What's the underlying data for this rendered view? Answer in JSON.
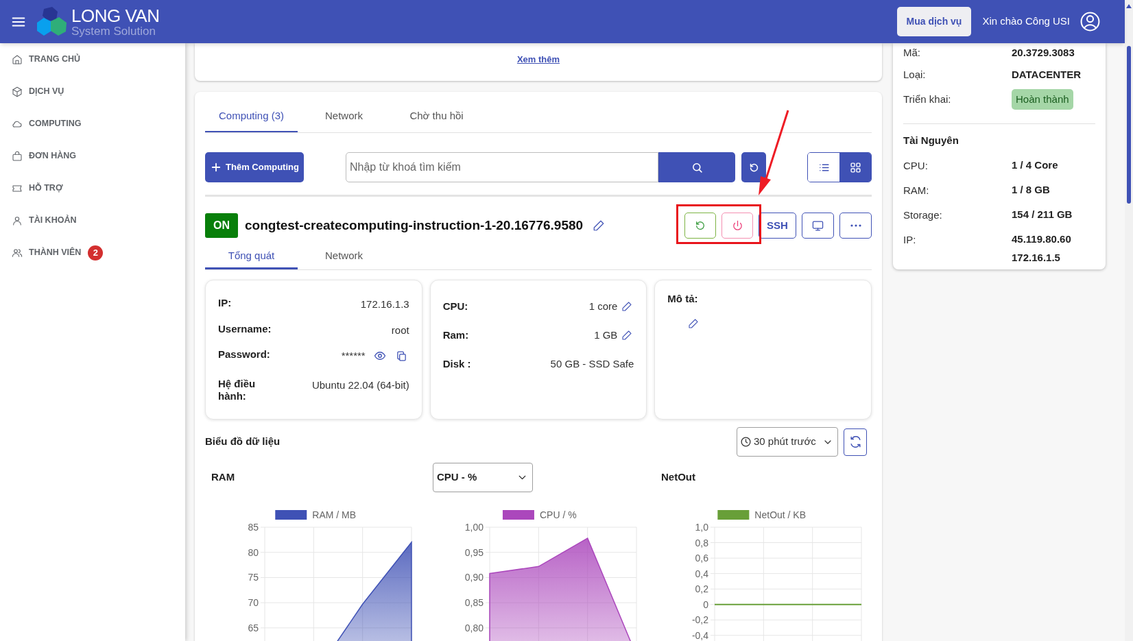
{
  "header": {
    "brand_title": "LONG VAN",
    "brand_subtitle": "System Solution",
    "buy_button": "Mua dịch vụ",
    "greeting": "Xin chào Công USI"
  },
  "sidebar": {
    "items": [
      {
        "label": "TRANG CHỦ",
        "selected": false
      },
      {
        "label": "DỊCH VỤ",
        "selected": false
      },
      {
        "label": "COMPUTING",
        "selected": false
      },
      {
        "label": "ĐƠN HÀNG",
        "selected": false
      },
      {
        "label": "HỖ TRỢ",
        "selected": false
      },
      {
        "label": "TÀI KHOẢN",
        "selected": false
      },
      {
        "label": "THÀNH VIÊN",
        "selected": false,
        "badge": "2"
      }
    ]
  },
  "top_card": {
    "link": "Xem thêm"
  },
  "tabs": [
    {
      "label": "Computing (3)",
      "selected": true
    },
    {
      "label": "Network",
      "selected": false
    },
    {
      "label": "Chờ thu hồi",
      "selected": false
    }
  ],
  "toolbar": {
    "add_button": "Thêm Computing",
    "search": {
      "placeholder": "Nhập từ khoá tìm kiếm"
    },
    "view_modes": [
      {
        "selected": false
      },
      {
        "selected": true
      }
    ]
  },
  "server": {
    "status": "ON",
    "name": "congtest-createcomputing-instruction-1-20.16776.9580",
    "ssh_button": "SSH",
    "subtabs": [
      {
        "label": "Tổng quát",
        "selected": true
      },
      {
        "label": "Network",
        "selected": false
      }
    ],
    "access": [
      {
        "label": "IP:",
        "value": "172.16.1.3"
      },
      {
        "label": "Username:",
        "value": "root"
      },
      {
        "label": "Password:",
        "value": "******",
        "kind": "secret"
      },
      {
        "label": "Hệ điều hành:",
        "value": "Ubuntu 22.04 (64-bit)"
      }
    ],
    "specs": [
      {
        "label": "CPU:",
        "value": "1 core",
        "editable": true
      },
      {
        "label": "Ram:",
        "value": "1 GB",
        "editable": true
      },
      {
        "label": "Disk :",
        "value": "50 GB - SSD Safe",
        "editable": false
      }
    ],
    "description": {
      "label": "Mô tả:"
    }
  },
  "charts_section": {
    "title": "Biểu đồ dữ liệu",
    "time_range": "30 phút trước",
    "charts": [
      {
        "title": "RAM",
        "chart_data": {
          "type": "area",
          "grid": true,
          "ylim": [
            50,
            85
          ],
          "yticks": [
            65,
            70,
            75,
            80,
            85
          ],
          "series": [
            {
              "name": "RAM / MB",
              "color": "#3f51b5",
              "values": [
                55,
                55.4,
                69.7,
                82
              ]
            }
          ]
        }
      },
      {
        "selector": "CPU - %",
        "chart_data": {
          "type": "area",
          "grid": true,
          "ylim": [
            0.65,
            1.0
          ],
          "yticks": [
            {
              "value": 0.8,
              "label": "0,80"
            },
            {
              "value": 0.85,
              "label": "0,85"
            },
            {
              "value": 0.9,
              "label": "0,90"
            },
            {
              "value": 0.95,
              "label": "0,95"
            },
            {
              "value": 1.0,
              "label": "1,00"
            }
          ],
          "series": [
            {
              "name": "CPU / %",
              "color": "#ab47bc",
              "values": [
                0.908,
                0.922,
                0.978,
                0.745
              ]
            }
          ]
        }
      },
      {
        "title": "NetOut",
        "chart_data": {
          "type": "line",
          "grid": true,
          "ylim": [
            -1.28,
            1.0
          ],
          "yticks": [
            {
              "value": -0.4,
              "label": "-0,4"
            },
            {
              "value": -0.2,
              "label": "-0,2"
            },
            {
              "value": 0,
              "label": "0"
            },
            {
              "value": 0.2,
              "label": "0,2"
            },
            {
              "value": 0.4,
              "label": "0,4"
            },
            {
              "value": 0.6,
              "label": "0,6"
            },
            {
              "value": 0.8,
              "label": "0,8"
            },
            {
              "value": 1.0,
              "label": "1,0"
            }
          ],
          "series": [
            {
              "name": "NetOut / KB",
              "color": "#689f38",
              "values": [
                0,
                0,
                0,
                0
              ]
            }
          ]
        }
      }
    ]
  },
  "info_panel": {
    "rows": [
      {
        "label": "Mã:",
        "value": "20.3729.3083"
      },
      {
        "label": "Loại:",
        "value": "DATACENTER"
      },
      {
        "label": "Triển khai:",
        "value": "Hoàn thành",
        "kind": "badge"
      }
    ],
    "resources_title": "Tài Nguyên",
    "resources": [
      {
        "label": "CPU:",
        "values": [
          "1 / 4 Core"
        ]
      },
      {
        "label": "RAM:",
        "values": [
          "1 / 8 GB"
        ]
      },
      {
        "label": "Storage:",
        "values": [
          "154 / 211 GB"
        ]
      },
      {
        "label": "IP:",
        "values": [
          "45.119.80.60",
          "172.16.1.5"
        ]
      }
    ]
  }
}
